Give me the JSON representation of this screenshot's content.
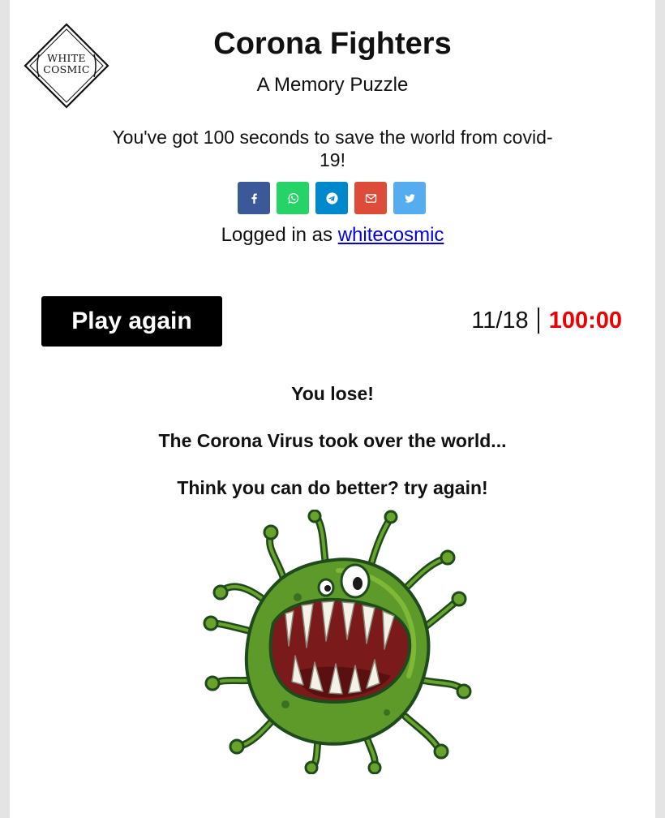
{
  "logo": {
    "line1": "WHITE",
    "line2": "COSMIC"
  },
  "header": {
    "title": "Corona Fighters",
    "subtitle": "A Memory Puzzle",
    "tagline": "You've got 100 seconds to save the world from covid-19!"
  },
  "share": [
    {
      "name": "facebook",
      "color": "#3b5998"
    },
    {
      "name": "whatsapp",
      "color": "#25d366"
    },
    {
      "name": "telegram",
      "color": "#0088cc"
    },
    {
      "name": "email",
      "color": "#dd4b39"
    },
    {
      "name": "twitter",
      "color": "#55acee"
    }
  ],
  "login": {
    "prefix": "Logged in as",
    "username": "whitecosmic"
  },
  "game": {
    "play_again_label": "Play again",
    "score": "11/18",
    "timer": "100:00",
    "timer_color": "#ee0000"
  },
  "result": {
    "line1": "You lose!",
    "line2": "The Corona Virus took over the world...",
    "line3": "Think you can do better? try again!"
  },
  "icons": [
    "facebook-icon",
    "whatsapp-icon",
    "telegram-icon",
    "email-icon",
    "twitter-icon",
    "virus-monster-icon"
  ]
}
